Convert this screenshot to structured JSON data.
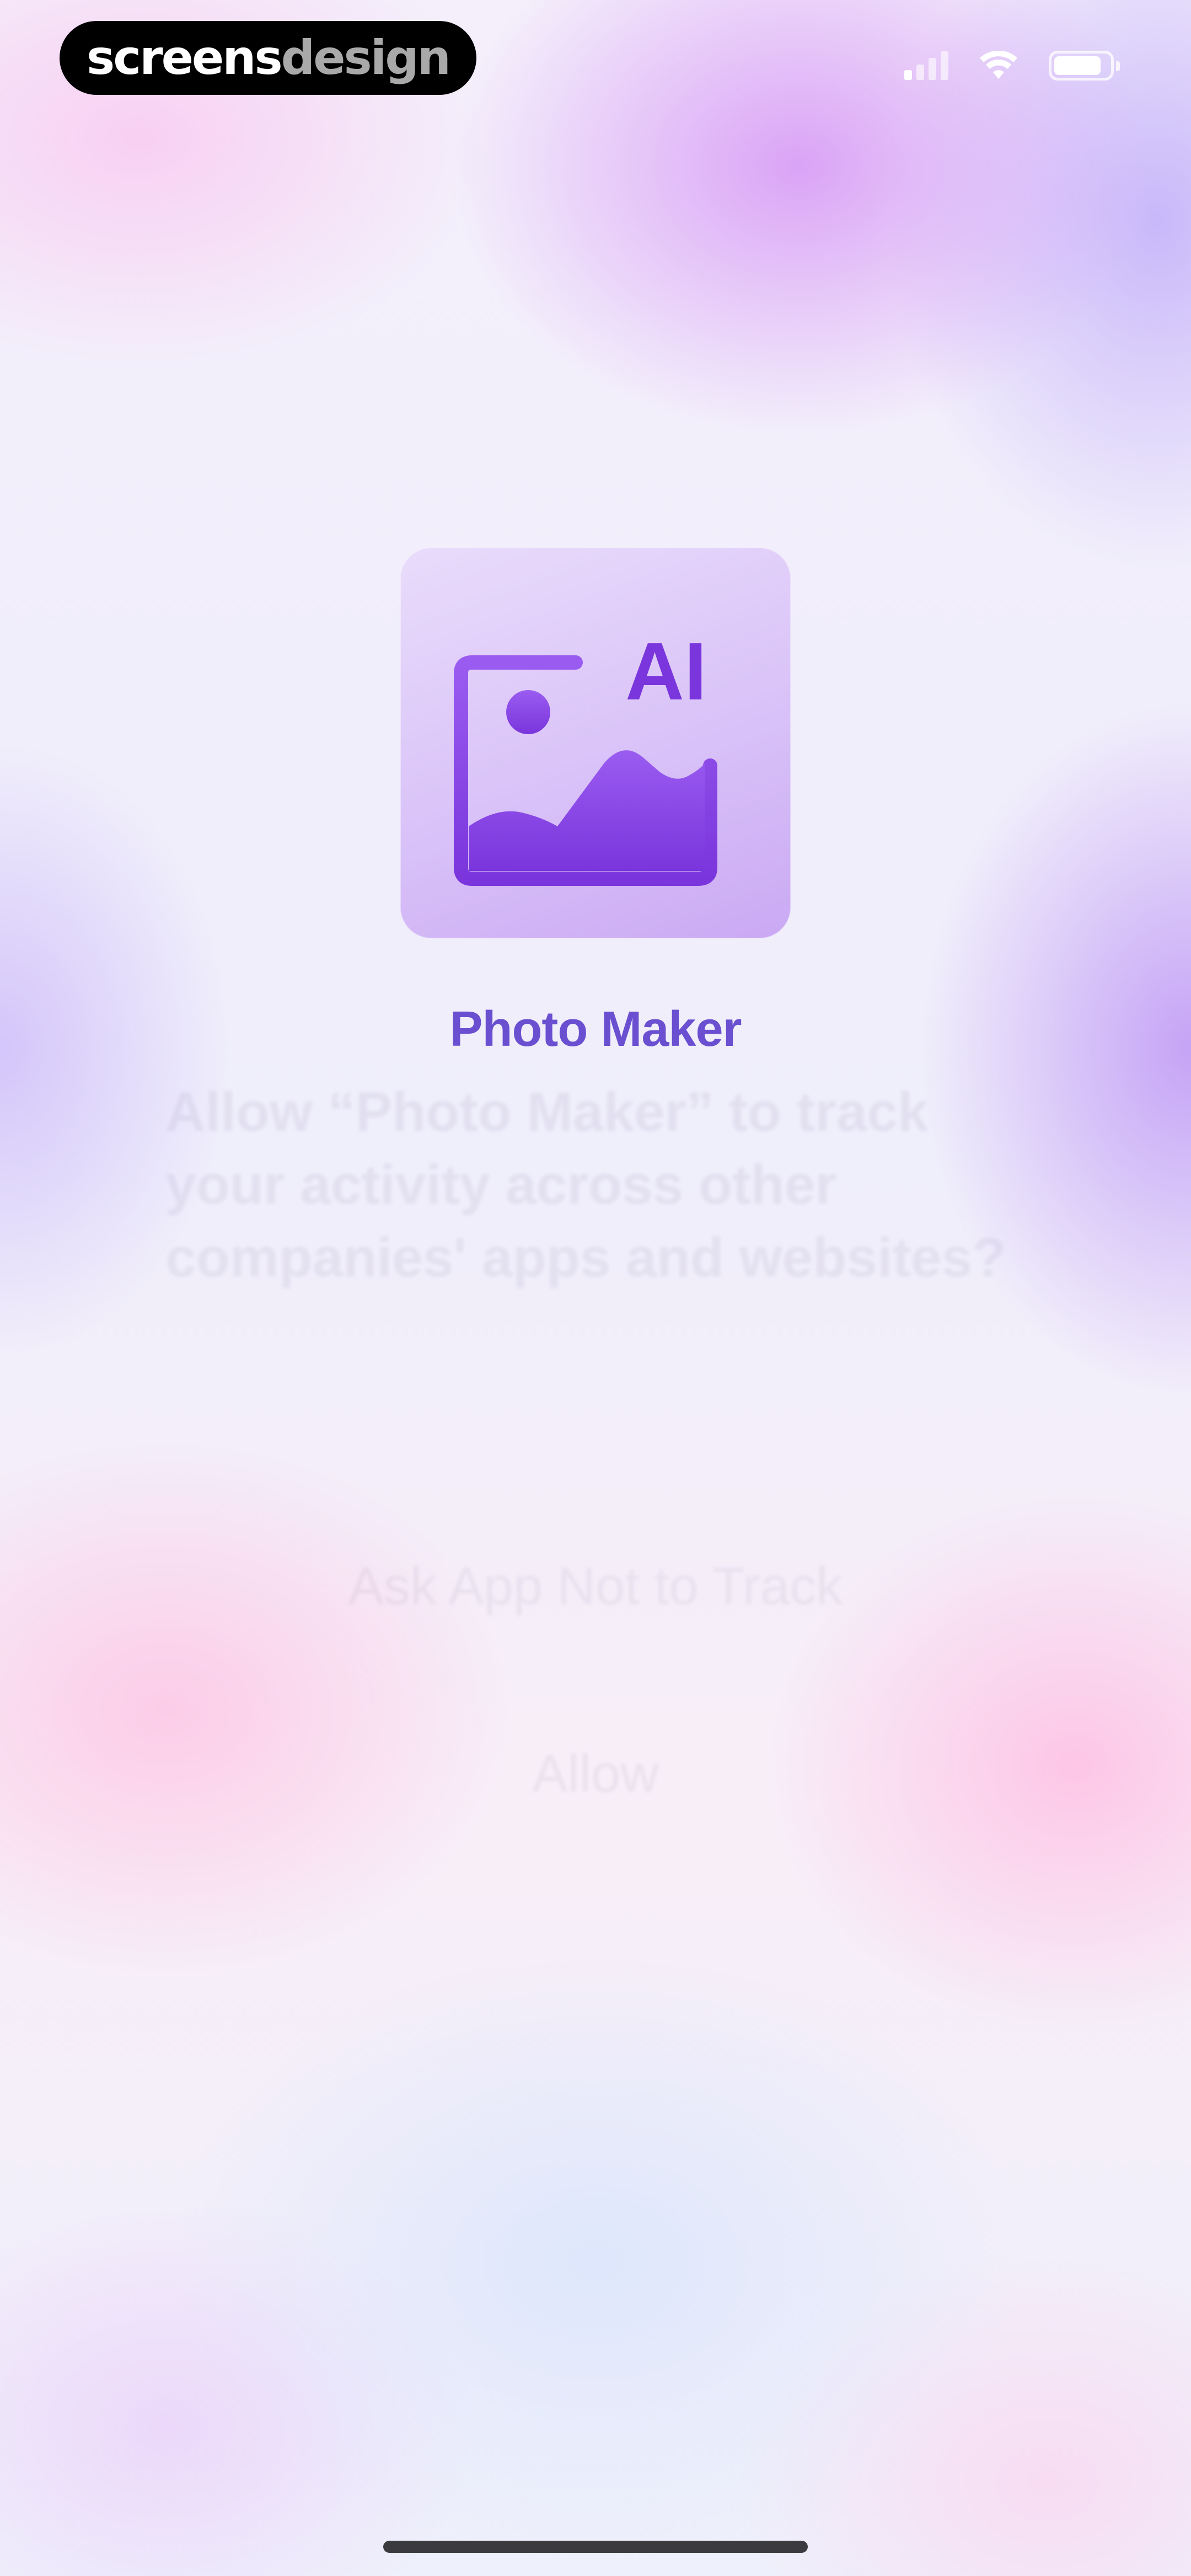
{
  "watermark": {
    "part1": "screens",
    "part2": "design"
  },
  "status_bar": {
    "signal_icon": "cellular-signal-icon",
    "wifi_icon": "wifi-icon",
    "battery_icon": "battery-icon"
  },
  "app": {
    "name": "Photo Maker",
    "icon": "ai-photo-icon",
    "icon_badge_text": "AI",
    "accent_color": "#6a4fd0"
  },
  "tracking_dialog": {
    "message": "Allow “Photo Maker” to track your activity across other companies' apps and websites?",
    "ask_not_to_track_label": "Ask App Not to Track",
    "allow_label": "Allow"
  }
}
